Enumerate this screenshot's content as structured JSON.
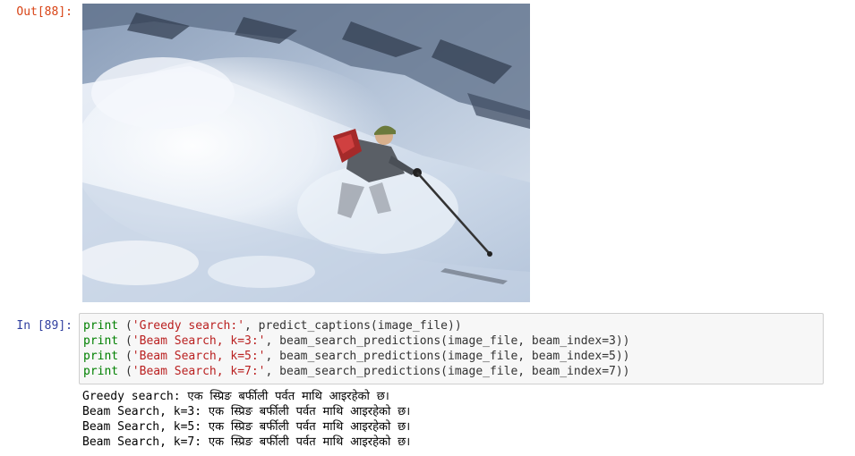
{
  "cells": {
    "out_prompt": "Out[88]:",
    "in_prompt": "In [89]:"
  },
  "image": {
    "subject": "skier descending a snowy mountain slope"
  },
  "code": {
    "lines": [
      {
        "fn": "print",
        "pre": " (",
        "str": "'Greedy search:'",
        "post": ", predict_captions(image_file))"
      },
      {
        "fn": "print",
        "pre": " (",
        "str": "'Beam Search, k=3:'",
        "post": ", beam_search_predictions(image_file, beam_index=3))"
      },
      {
        "fn": "print",
        "pre": " (",
        "str": "'Beam Search, k=5:'",
        "post": ", beam_search_predictions(image_file, beam_index=5))"
      },
      {
        "fn": "print",
        "pre": " (",
        "str": "'Beam Search, k=7:'",
        "post": ", beam_search_predictions(image_file, beam_index=7))"
      }
    ]
  },
  "output": {
    "lines": [
      "Greedy search: एक स्प्रिङ बर्फीली पर्वत माथि आइरहेको छ।",
      "Beam Search, k=3: एक स्प्रिङ बर्फीली पर्वत माथि आइरहेको छ।",
      "Beam Search, k=5: एक स्प्रिङ बर्फीली पर्वत माथि आइरहेको छ।",
      "Beam Search, k=7: एक स्प्रिङ बर्फीली पर्वत माथि आइरहेको छ।"
    ]
  },
  "colors": {
    "out_prompt": "#d84315",
    "in_prompt": "#303f9f",
    "keyword": "#008000",
    "string": "#ba2121",
    "input_bg": "#f7f7f7",
    "input_border": "#cfcfcf"
  }
}
